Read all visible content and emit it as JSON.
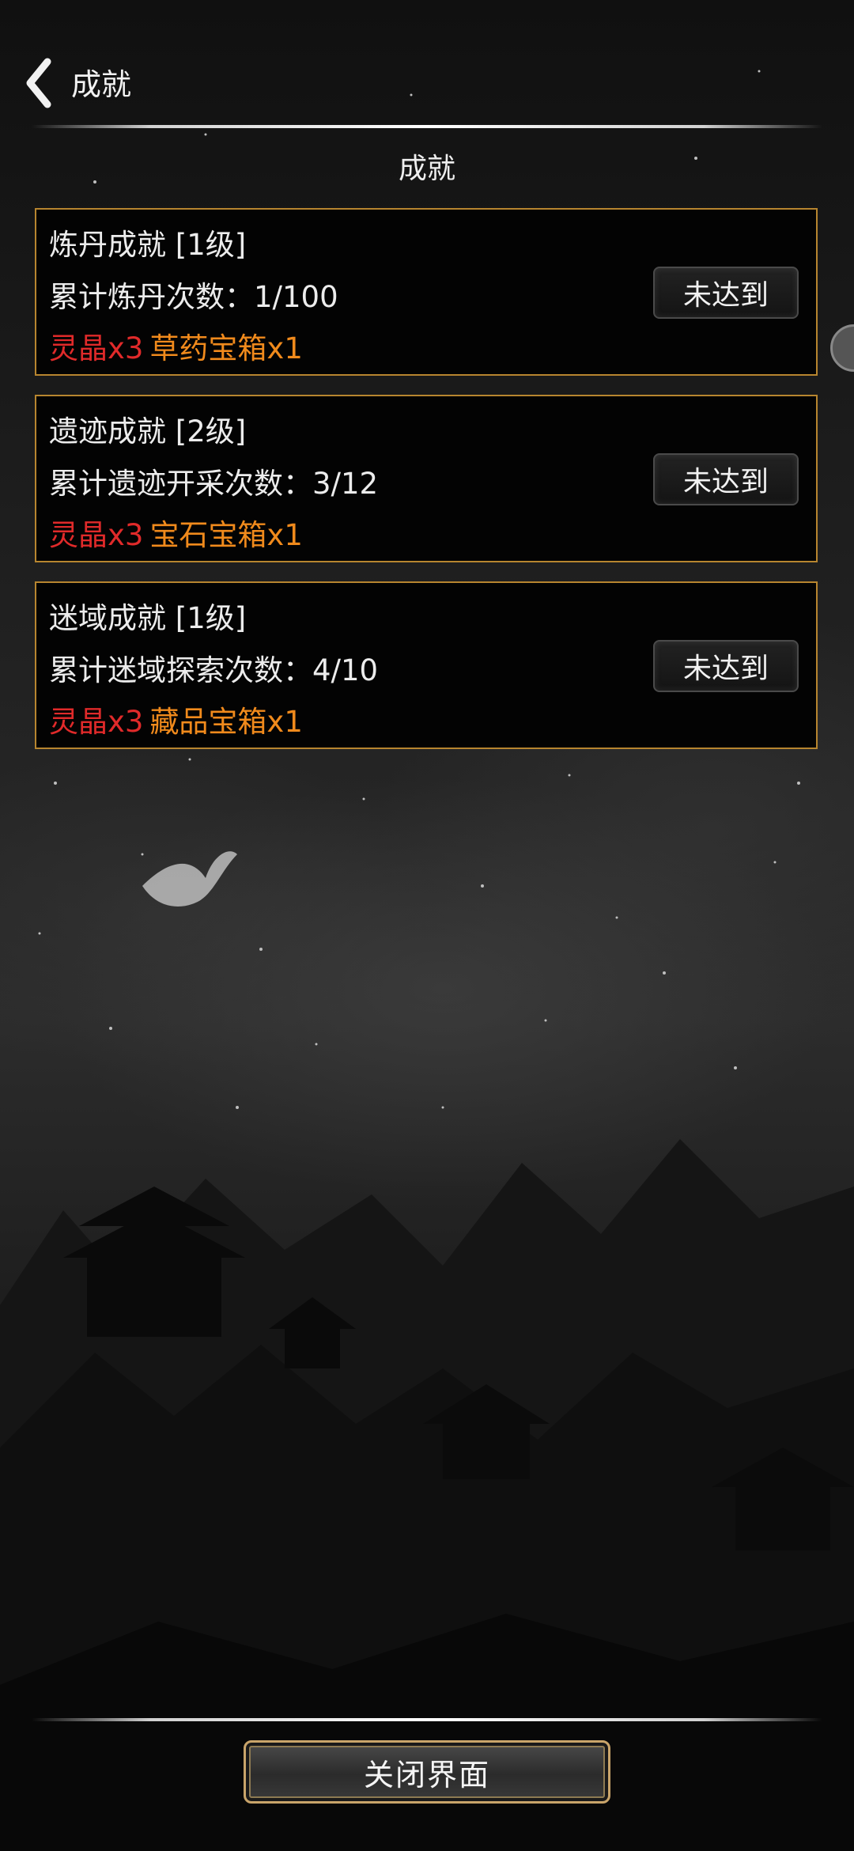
{
  "header": {
    "title": "成就",
    "back_icon": "chevron-left-icon"
  },
  "section": {
    "title": "成就"
  },
  "achievements": [
    {
      "name": "炼丹成就 [1级]",
      "progress": "累计炼丹次数：1/100",
      "reward_main": "灵晶x3",
      "reward_extra": "草药宝箱x1",
      "status": "未达到"
    },
    {
      "name": "遗迹成就 [2级]",
      "progress": "累计遗迹开采次数：3/12",
      "reward_main": "灵晶x3",
      "reward_extra": "宝石宝箱x1",
      "status": "未达到"
    },
    {
      "name": "迷域成就 [1级]",
      "progress": "累计迷域探索次数：4/10",
      "reward_main": "灵晶x3",
      "reward_extra": "藏品宝箱x1",
      "status": "未达到"
    }
  ],
  "footer": {
    "close_label": "关闭界面"
  },
  "colors": {
    "card_border": "#b7852f",
    "reward_red": "#e02a2a",
    "reward_orange": "#f08a1c"
  }
}
